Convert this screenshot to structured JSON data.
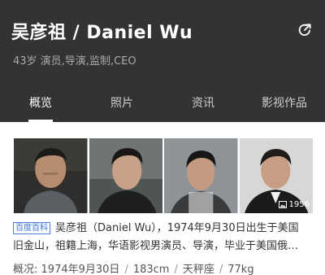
{
  "header": {
    "title": "吴彦祖 / Daniel Wu",
    "subtitle": "43岁 演员,导演,监制,CEO"
  },
  "tabs": [
    {
      "label": "概览",
      "active": true
    },
    {
      "label": "照片",
      "active": false
    },
    {
      "label": "资讯",
      "active": false
    },
    {
      "label": "影视作品",
      "active": false
    }
  ],
  "photos": {
    "count": "1956"
  },
  "description": {
    "tag": "百度百科",
    "line1": "吴彦祖（Daniel Wu），1974年9月30日出生于美国",
    "line2": "旧金山，祖籍上海，华语影视男演员、导演，毕业于美国俄…"
  },
  "facts": {
    "label": "概况:",
    "birth": "1974年9月30日",
    "height": "183cm",
    "zodiac": "天秤座",
    "weight": "77kg"
  },
  "colors": {
    "header_bg": "#333333",
    "tag_blue": "#3b73d8"
  }
}
